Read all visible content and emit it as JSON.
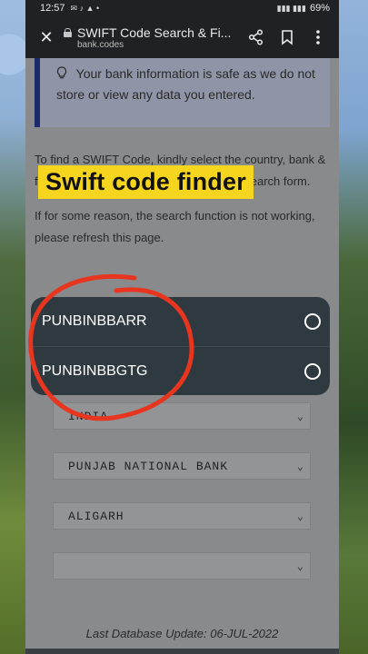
{
  "status_bar": {
    "time": "12:57",
    "battery": "69%"
  },
  "browser": {
    "title": "SWIFT Code Search & Fi...",
    "domain": "bank.codes"
  },
  "notice": {
    "text": "Your bank information is safe as we do not store or view any data you entered."
  },
  "instructions": {
    "para1": "To find a SWIFT Code, kindly select the country, bank & finder will display the result beneath the search form.",
    "para2": "If for some reason, the search function is not working, please refresh this page."
  },
  "overlay": {
    "title": "Swift code finder"
  },
  "popup": {
    "options": [
      {
        "label": "PUNBINBBARR"
      },
      {
        "label": "PUNBINBBGTG"
      }
    ]
  },
  "selects": [
    {
      "value": "INDIA"
    },
    {
      "value": "PUNJAB NATIONAL BANK"
    },
    {
      "value": "ALIGARH"
    },
    {
      "value": ""
    }
  ],
  "footer": {
    "text": "Last Database Update: 06-JUL-2022"
  },
  "colors": {
    "overlay_bg": "#f6d51e",
    "popup_bg": "#2e3a40",
    "annotation": "#e8351f",
    "notice_border": "#1a2a6c"
  },
  "icons": {
    "close": "close-icon",
    "share": "share-icon",
    "bookmark": "bookmark-icon",
    "menu": "more-vert-icon",
    "bulb": "lightbulb-icon"
  }
}
